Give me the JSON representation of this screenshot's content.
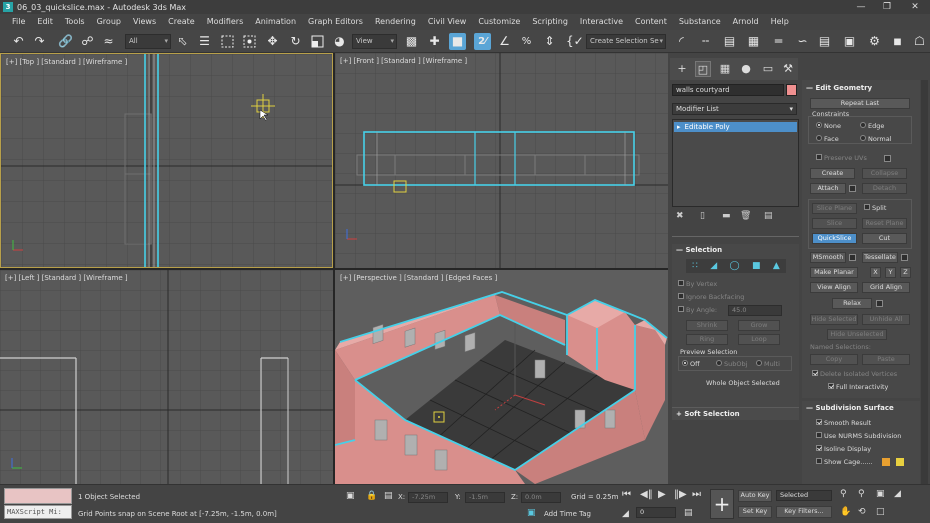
{
  "window": {
    "title": "06_03_quickslice.max - Autodesk 3ds Max",
    "app_icon": "3ds-max-icon"
  },
  "menu": [
    "File",
    "Edit",
    "Tools",
    "Group",
    "Views",
    "Create",
    "Modifiers",
    "Animation",
    "Graph Editors",
    "Rendering",
    "Civil View",
    "Customize",
    "Scripting",
    "Interactive",
    "Content",
    "Substance",
    "Arnold",
    "Help"
  ],
  "toolbar": {
    "filter_value": "All",
    "refcoord_value": "View",
    "selset_value": "Create Selection Se"
  },
  "viewports": {
    "top": {
      "label": "[+] [Top ] [Standard ] [Wireframe ]",
      "active": true
    },
    "front": {
      "label": "[+] [Front ] [Standard ] [Wireframe ]"
    },
    "left": {
      "label": "[+] [Left ] [Standard ] [Wireframe ]"
    },
    "perspective": {
      "label": "[+] [Perspective ] [Standard ] [Edged Faces ]"
    }
  },
  "command_panel": {
    "object_name": "walls courtyard",
    "object_color": "#f09090",
    "modifier_list_label": "Modifier List",
    "stack_item": "Editable Poly",
    "selection": {
      "title": "Selection",
      "by_vertex": "By Vertex",
      "ignore_backfacing": "Ignore Backfacing",
      "by_angle": "By Angle:",
      "angle_value": "45.0",
      "shrink": "Shrink",
      "grow": "Grow",
      "ring": "Ring",
      "loop": "Loop",
      "preview_selection": "Preview Selection",
      "off": "Off",
      "subobj": "SubObj",
      "multi": "Multi",
      "whole_object_selected": "Whole Object Selected"
    },
    "soft_selection": {
      "title": "Soft Selection"
    },
    "edit_geometry": {
      "title": "Edit Geometry",
      "repeat_last": "Repeat Last",
      "constraints": "Constraints",
      "none": "None",
      "edge": "Edge",
      "face": "Face",
      "normal": "Normal",
      "preserve_uvs": "Preserve UVs",
      "create": "Create",
      "collapse": "Collapse",
      "attach": "Attach",
      "detach": "Detach",
      "slice_plane": "Slice Plane",
      "split": "Split",
      "slice": "Slice",
      "reset_plane": "Reset Plane",
      "quickslice": "QuickSlice",
      "cut": "Cut",
      "msmooth": "MSmooth",
      "tessellate": "Tessellate",
      "make_planar": "Make Planar",
      "x": "X",
      "y": "Y",
      "z": "Z",
      "view_align": "View Align",
      "grid_align": "Grid Align",
      "relax": "Relax",
      "hide_selected": "Hide Selected",
      "unhide_all": "Unhide All",
      "hide_unselected": "Hide Unselected",
      "named_selections": "Named Selections:",
      "copy": "Copy",
      "paste": "Paste",
      "delete_isolated": "Delete Isolated Vertices",
      "full_interactivity": "Full Interactivity"
    },
    "subdivision_surface": {
      "title": "Subdivision Surface",
      "smooth_result": "Smooth Result",
      "use_nurms": "Use NURMS Subdivision",
      "isoline_display": "Isoline Display",
      "show_cage": "Show Cage......"
    }
  },
  "status": {
    "maxscript": "MAXScript Mi:",
    "selected": "1 Object Selected",
    "prompt": "Grid Points snap on Scene Root at [-7.25m, -1.5m, 0.0m]",
    "x_label": "X:",
    "x_value": "-7.25m",
    "y_label": "Y:",
    "y_value": "-1.5m",
    "z_label": "Z:",
    "z_value": "0.0m",
    "grid": "Grid = 0.25m",
    "add_time_tag": "Add Time Tag",
    "auto_key": "Auto Key",
    "set_key": "Set Key",
    "selected_dropdown": "Selected",
    "key_filters": "Key Filters...",
    "frame_value": "0"
  },
  "colors": {
    "wire_highlight": "#46d0e8",
    "wall_face": "#d98f8c",
    "active_border": "#b8a04a",
    "accent": "#4d8fc9"
  }
}
